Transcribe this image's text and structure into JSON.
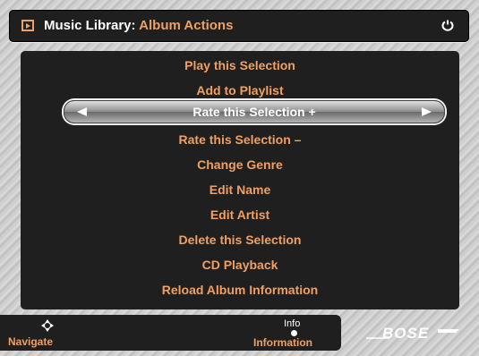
{
  "header": {
    "title": "Music Library:",
    "subtitle": "Album Actions",
    "left_icon": "play-box-icon",
    "right_icon": "power-icon"
  },
  "menu": {
    "selected_index": 2,
    "items": [
      "Play this Selection",
      "Add to Playlist",
      "Rate this Selection +",
      "Rate this Selection –",
      "Change Genre",
      "Edit Name",
      "Edit Artist",
      "Delete this Selection",
      "CD Playback",
      "Reload Album Information"
    ]
  },
  "footer": {
    "navigate_label": "Navigate",
    "info_label": "Info",
    "information_label": "Information"
  },
  "brand": {
    "logo_text": "BOSE"
  },
  "colors": {
    "accent": "#f0a063",
    "panel": "#1f1f1f",
    "text_white": "#ffffff"
  }
}
